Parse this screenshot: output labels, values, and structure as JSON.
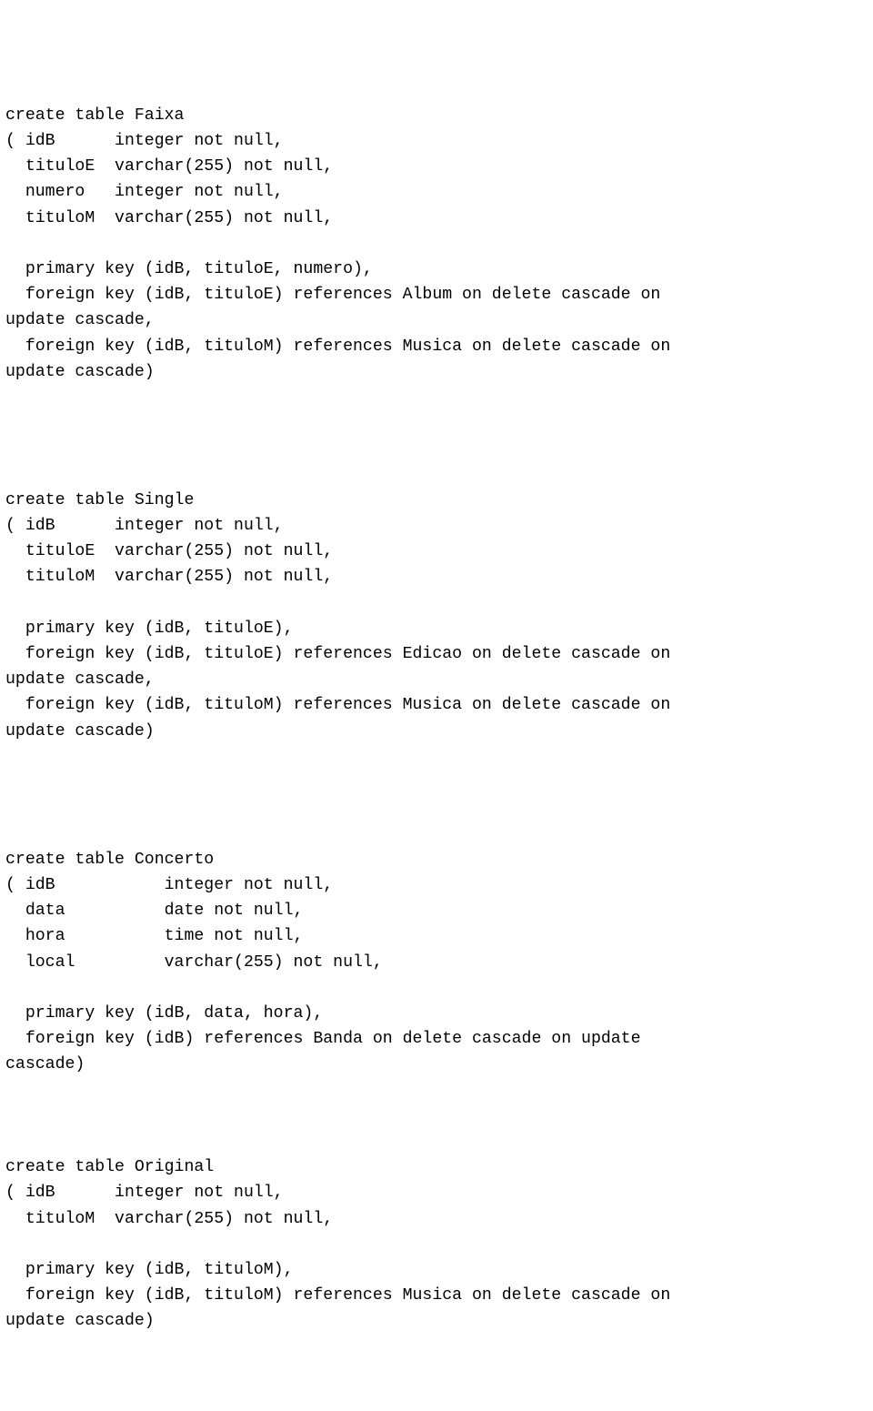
{
  "tables": {
    "faixa": {
      "header": "create table Faixa",
      "cols": [
        "( idB      integer not null,",
        "  tituloE  varchar(255) not null,",
        "  numero   integer not null,",
        "  tituloM  varchar(255) not null,"
      ],
      "constraints": [
        "  primary key (idB, tituloE, numero),",
        "  foreign key (idB, tituloE) references Album on delete cascade on",
        "update cascade,",
        "  foreign key (idB, tituloM) references Musica on delete cascade on",
        "update cascade)"
      ]
    },
    "single": {
      "header": "create table Single",
      "cols": [
        "( idB      integer not null,",
        "  tituloE  varchar(255) not null,",
        "  tituloM  varchar(255) not null,"
      ],
      "constraints": [
        "  primary key (idB, tituloE),",
        "  foreign key (idB, tituloE) references Edicao on delete cascade on",
        "update cascade,",
        "  foreign key (idB, tituloM) references Musica on delete cascade on",
        "update cascade)"
      ]
    },
    "concerto": {
      "header": "create table Concerto",
      "cols": [
        "( idB           integer not null,",
        "  data          date not null,",
        "  hora          time not null,",
        "  local         varchar(255) not null,"
      ],
      "constraints": [
        "  primary key (idB, data, hora),",
        "  foreign key (idB) references Banda on delete cascade on update",
        "cascade)"
      ]
    },
    "original": {
      "header": "create table Original",
      "cols": [
        "( idB      integer not null,",
        "  tituloM  varchar(255) not null,"
      ],
      "constraints": [
        "  primary key (idB, tituloM),",
        "  foreign key (idB, tituloM) references Musica on delete cascade on",
        "update cascade)"
      ]
    }
  }
}
